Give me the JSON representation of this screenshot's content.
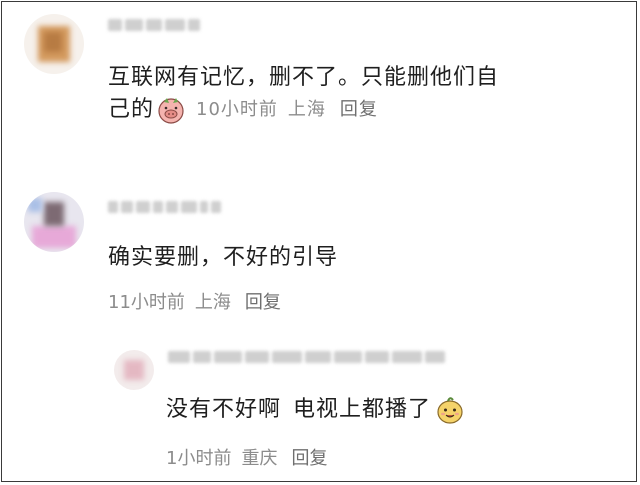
{
  "comments": [
    {
      "text_line1": "互联网有记忆，删不了。只能删他们自",
      "text_line2": "己的",
      "emoji": "pig-face-emoji",
      "time": "10小时前",
      "location": "上海",
      "reply_label": "回复"
    },
    {
      "text": "确实要删，不好的引导",
      "time": "11小时前",
      "location": "上海",
      "reply_label": "回复"
    }
  ],
  "reply": {
    "text_part1": "没有不好啊",
    "text_part2": "电视上都播了",
    "emoji": "smiling-bean-emoji",
    "time": "1小时前",
    "location": "重庆",
    "reply_label": "回复"
  }
}
